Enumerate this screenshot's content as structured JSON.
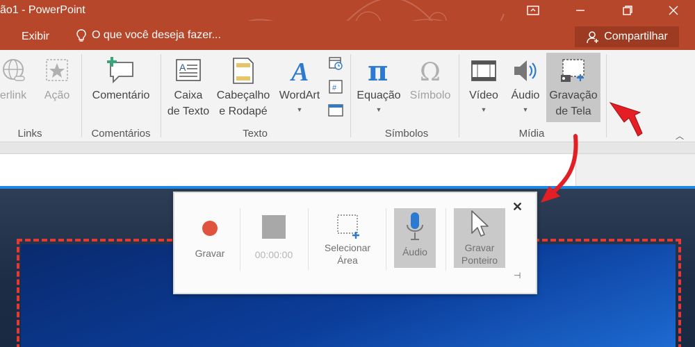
{
  "titlebar": {
    "title": "ão1 - PowerPoint",
    "icons": [
      "ribbon-display-icon",
      "minimize-icon",
      "restore-icon",
      "close-icon"
    ]
  },
  "menubar": {
    "exibir": "Exibir",
    "tell_me": "O que você deseja fazer...",
    "share": "Compartilhar"
  },
  "ribbon": {
    "links_group": {
      "label": "Links",
      "hyperlink": "erlink",
      "acao": "Ação"
    },
    "comentarios_group": {
      "label": "Comentários",
      "comentario": "Comentário"
    },
    "texto_group": {
      "label": "Texto",
      "caixa_l1": "Caixa",
      "caixa_l2": "de Texto",
      "cab_l1": "Cabeçalho",
      "cab_l2": "e Rodapé",
      "wordart": "WordArt"
    },
    "simbolos_group": {
      "label": "Símbolos",
      "equacao": "Equação",
      "simbolo": "Símbolo"
    },
    "midia_group": {
      "label": "Mídia",
      "video": "Vídeo",
      "audio": "Áudio",
      "grav_l1": "Gravação",
      "grav_l2": "de Tela"
    }
  },
  "recorder": {
    "gravar": "Gravar",
    "timer": "00:00:00",
    "sel_l1": "Selecionar",
    "sel_l2": "Área",
    "audio": "Áudio",
    "ptr_l1": "Gravar",
    "ptr_l2": "Ponteiro"
  },
  "colors": {
    "accent": "#b7472a",
    "record": "#e0533e",
    "annotation": "#e53935"
  }
}
